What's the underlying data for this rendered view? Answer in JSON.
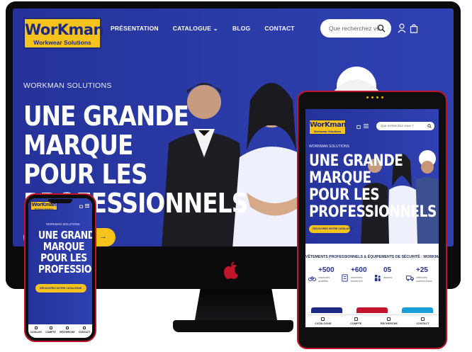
{
  "brand": {
    "name": "WorKman",
    "tagline": "Workwear Solutions",
    "yellow": "#f6c21c",
    "blue": "#25329a",
    "red_frame": "#c2152b"
  },
  "desktop": {
    "nav": {
      "items": [
        "PRÉSENTATION",
        "CATALOGUE",
        "BLOG",
        "CONTACT"
      ]
    },
    "search": {
      "placeholder": "Que recherchez vous ?"
    },
    "hero": {
      "kicker": "WORKMAN SOLUTIONS",
      "title_lines": [
        "UNE GRANDE",
        "MARQUE",
        "POUR LES",
        "PROFESSIONNELS"
      ],
      "cta_arrow": "→"
    },
    "icons": [
      "search-icon",
      "user-icon",
      "bag-icon",
      "apple-logo-icon"
    ]
  },
  "tablet": {
    "search": {
      "placeholder": "Que recherchez vous ?"
    },
    "hero": {
      "kicker": "WORKMAN SOLUTIONS",
      "title_lines": [
        "UNE GRANDE",
        "MARQUE",
        "POUR LES",
        "PROFESSIONNELS"
      ],
      "cta": "DÉCOUVREZ NOTRE CATALOGUE →"
    },
    "strip": "VÊTEMENTS PROFESSIONNELS & ÉQUIPEMENTS DE SÉCURITÉ : WORKMAN, VOTRE FOURNISSEUR",
    "stats": [
      {
        "value": "+500",
        "label": "employés qualifiés",
        "icon": "bike-icon"
      },
      {
        "value": "+600",
        "label": "machines modernes",
        "icon": "document-icon"
      },
      {
        "value": "05",
        "label": "ateliers",
        "icon": "workers-icon"
      },
      {
        "value": "+25",
        "label": "véhicules commerciaux",
        "icon": "truck-icon"
      }
    ],
    "tabbar": [
      "CATALOGUE",
      "COMPTE",
      "RECHERCHE",
      "CONTACT"
    ]
  },
  "phone": {
    "hero": {
      "kicker": "WORKMAN SOLUTIONS",
      "title_lines": [
        "UNE GRANDE",
        "MARQUE",
        "POUR LES",
        "PROFESSIONNEL"
      ],
      "cta": "DÉCOUVREZ NOTRE CATALOGUE →"
    },
    "tabbar": [
      "CATALOG",
      "COMPTE",
      "RECHERCHE",
      "CONTACT"
    ]
  }
}
